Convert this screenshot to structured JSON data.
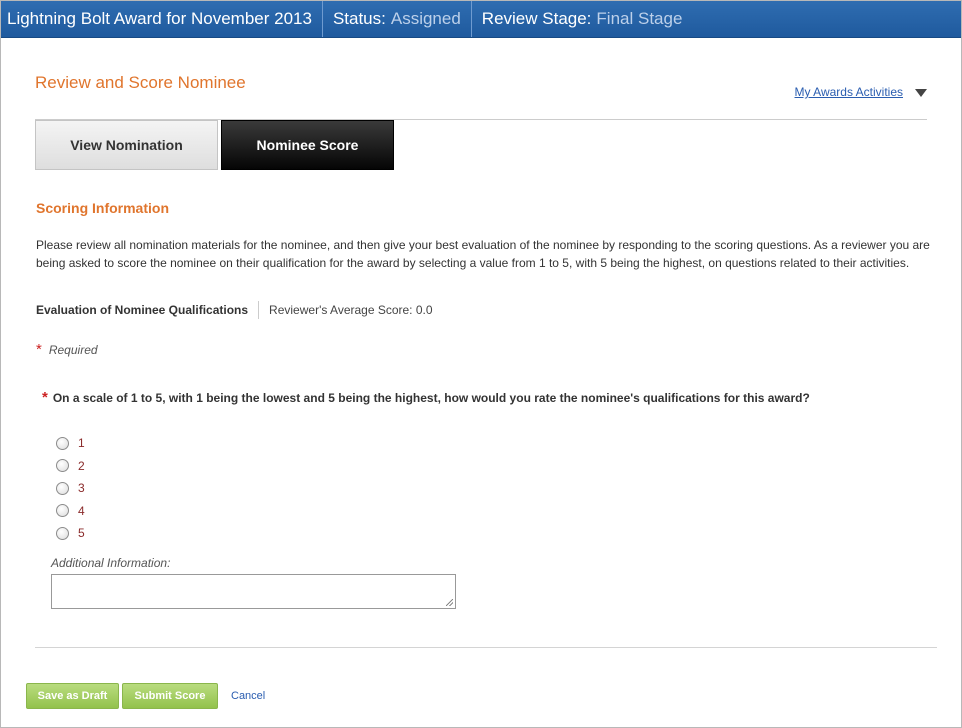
{
  "header": {
    "award_title": "Lightning Bolt Award for November 2013",
    "status_label": "Status:",
    "status_value": "Assigned",
    "stage_label": "Review Stage:",
    "stage_value": "Final Stage"
  },
  "page": {
    "title": "Review and Score Nominee",
    "activities_link": "My Awards Activities"
  },
  "tabs": [
    {
      "label": "View Nomination",
      "active": false
    },
    {
      "label": "Nominee Score",
      "active": true
    }
  ],
  "scoring": {
    "section_title": "Scoring Information",
    "description": "Please review all nomination materials for the nominee, and then give your best evaluation of the nominee by responding to the scoring questions. As a reviewer you are being asked to score the nominee on their qualification for the award by selecting a value from 1 to 5, with 5 being the highest, on questions related to their activities.",
    "evaluation_label": "Evaluation of Nominee Qualifications",
    "average_score": "Reviewer's Average Score: 0.0",
    "required_marker": "*",
    "required_text": "Required",
    "question": "On a scale of 1 to 5, with 1 being the lowest and 5 being the highest, how would you rate the nominee's qualifications for this award?",
    "options": [
      "1",
      "2",
      "3",
      "4",
      "5"
    ],
    "selected_option": null,
    "additional_label": "Additional Information:",
    "additional_value": ""
  },
  "actions": {
    "save_draft": "Save as Draft",
    "submit": "Submit Score",
    "cancel": "Cancel"
  },
  "colors": {
    "header_blue": "#2563a8",
    "accent_orange": "#e0752d",
    "button_green": "#9ccb59",
    "link_blue": "#2a5db0",
    "required_red": "#cc2222"
  }
}
